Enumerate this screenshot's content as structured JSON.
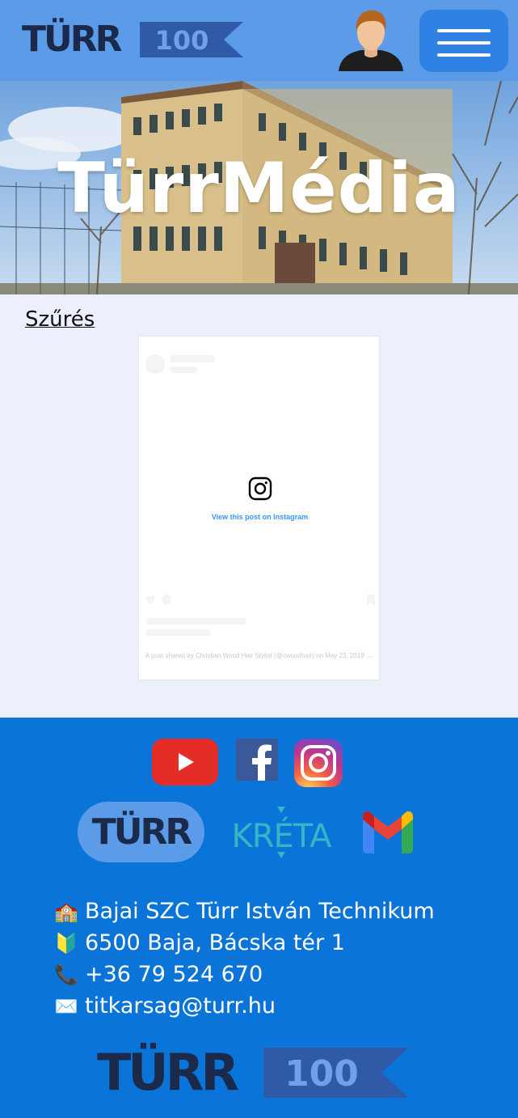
{
  "header": {
    "logo_text": "TÜRR",
    "logo_badge": "100",
    "avatar_icon": "user-avatar-icon",
    "menu_icon": "hamburger-menu-icon",
    "background_color": "#5b9be8",
    "menu_button_color": "#2f82e3"
  },
  "hero": {
    "title": "TürrMédia",
    "image": "school-building-photo"
  },
  "main": {
    "filter_link": "Szűrés",
    "embed": {
      "view_link": "View this post on Instagram",
      "caption": "A post shared by Christian Wood Hair Stylist (@cwoodhair) on May 23, 2019 ..."
    }
  },
  "footer": {
    "background_color": "#0b74d9",
    "social": [
      "youtube-icon",
      "facebook-icon",
      "instagram-icon"
    ],
    "links": {
      "turr_logo": "TÜRR",
      "kreta_logo": "KRÉTA",
      "gmail_icon": "gmail-icon"
    },
    "contact": {
      "school": "Bajai SZC Türr István Technikum",
      "address": "6500 Baja, Bácska tér 1",
      "phone": "+36 79 524 670",
      "email": "titkarsag@turr.hu"
    },
    "bottom_logo_text": "TÜRR",
    "bottom_logo_badge": "100"
  }
}
